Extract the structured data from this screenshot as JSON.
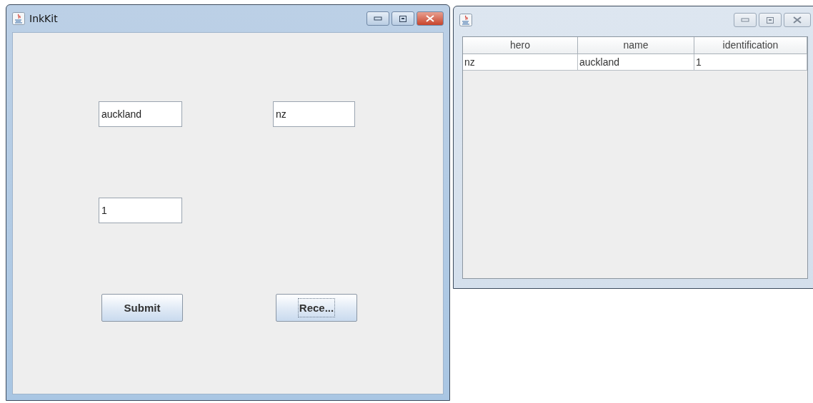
{
  "main_window": {
    "title": "InkKit",
    "active": true,
    "fields": [
      {
        "value": "auckland"
      },
      {
        "value": "nz"
      },
      {
        "value": "1"
      }
    ],
    "buttons": [
      {
        "label": "Submit",
        "focused": false
      },
      {
        "label": "Rece...",
        "focused": true
      }
    ]
  },
  "table_window": {
    "active": false,
    "table": {
      "columns": [
        "hero",
        "name",
        "identification"
      ],
      "rows": [
        [
          "nz",
          "auckland",
          "1"
        ]
      ]
    }
  }
}
